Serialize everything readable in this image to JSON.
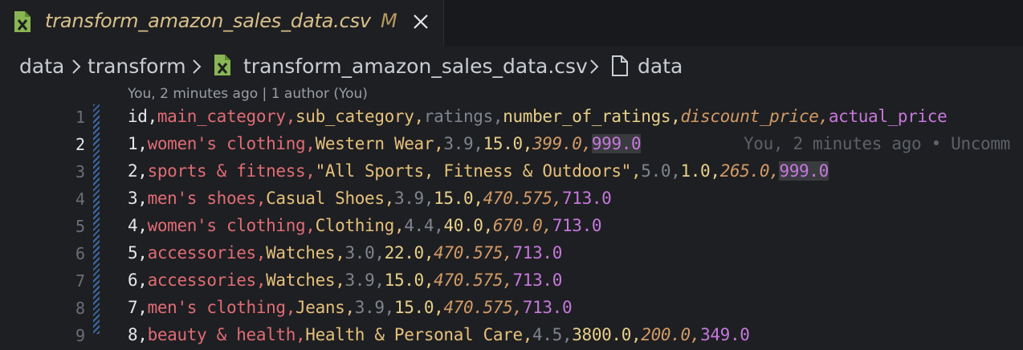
{
  "tab": {
    "icon": "csv-file-icon",
    "title": "transform_amazon_sales_data.csv",
    "modified": "M"
  },
  "breadcrumb": {
    "items": [
      "data",
      "transform",
      "transform_amazon_sales_data.csv",
      "data"
    ],
    "separator": ">"
  },
  "codelens": "You, 2 minutes ago | 1 author (You)",
  "blame": "You, 2 minutes ago • Uncomm",
  "lines": [
    {
      "n": "1",
      "cols": [
        "id",
        "main_category",
        "sub_category",
        "ratings",
        "number_of_ratings",
        "discount_price",
        "actual_price"
      ]
    },
    {
      "n": "2",
      "cols": [
        "1",
        "women's clothing",
        "Western Wear",
        "3.9",
        "15.0",
        "399.0",
        "999.0"
      ]
    },
    {
      "n": "3",
      "cols": [
        "2",
        "sports & fitness",
        "\"All Sports, Fitness & Outdoors\"",
        "5.0",
        "1.0",
        "265.0",
        "999.0"
      ]
    },
    {
      "n": "4",
      "cols": [
        "3",
        "men's shoes",
        "Casual Shoes",
        "3.9",
        "15.0",
        "470.575",
        "713.0"
      ]
    },
    {
      "n": "5",
      "cols": [
        "4",
        "women's clothing",
        "Clothing",
        "4.4",
        "40.0",
        "670.0",
        "713.0"
      ]
    },
    {
      "n": "6",
      "cols": [
        "5",
        "accessories",
        "Watches",
        "3.0",
        "22.0",
        "470.575",
        "713.0"
      ]
    },
    {
      "n": "7",
      "cols": [
        "6",
        "accessories",
        "Watches",
        "3.9",
        "15.0",
        "470.575",
        "713.0"
      ]
    },
    {
      "n": "8",
      "cols": [
        "7",
        "men's clothing",
        "Jeans",
        "3.9",
        "15.0",
        "470.575",
        "713.0"
      ]
    },
    {
      "n": "9",
      "cols": [
        "8",
        "beauty & health",
        "Health & Personal Care",
        "4.5",
        "3800.0",
        "200.0",
        "349.0"
      ]
    }
  ],
  "colors": {
    "category": "#e06c75",
    "sub_category": "#e5c07b",
    "ratings": "#7f848e",
    "number_of_ratings": "#e8d08a",
    "discount_price": "#d19a66",
    "actual_price": "#c678dd"
  }
}
